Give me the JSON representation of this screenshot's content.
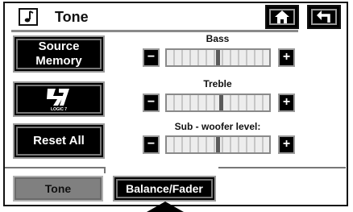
{
  "header": {
    "title": "Tone",
    "icon": "music-note-icon",
    "home_icon": "home-icon",
    "back_icon": "back-arrow-icon"
  },
  "left_buttons": {
    "source_memory": "Source\nMemory",
    "logic7_text": "LOGIC 7",
    "reset_all": "Reset All"
  },
  "sliders": [
    {
      "label": "Bass",
      "level": 0.5,
      "minus": "−",
      "plus": "+"
    },
    {
      "label": "Treble",
      "level": 0.53,
      "minus": "−",
      "plus": "+"
    },
    {
      "label": "Sub - woofer level:",
      "level": 0.5,
      "minus": "−",
      "plus": "+"
    }
  ],
  "tabs": [
    {
      "label": "Tone",
      "state": "inactive"
    },
    {
      "label": "Balance/Fader",
      "state": "active"
    }
  ],
  "colors": {
    "button_bg": "#000000",
    "track_bg": "#ededed",
    "tab_inactive": "#808080"
  }
}
